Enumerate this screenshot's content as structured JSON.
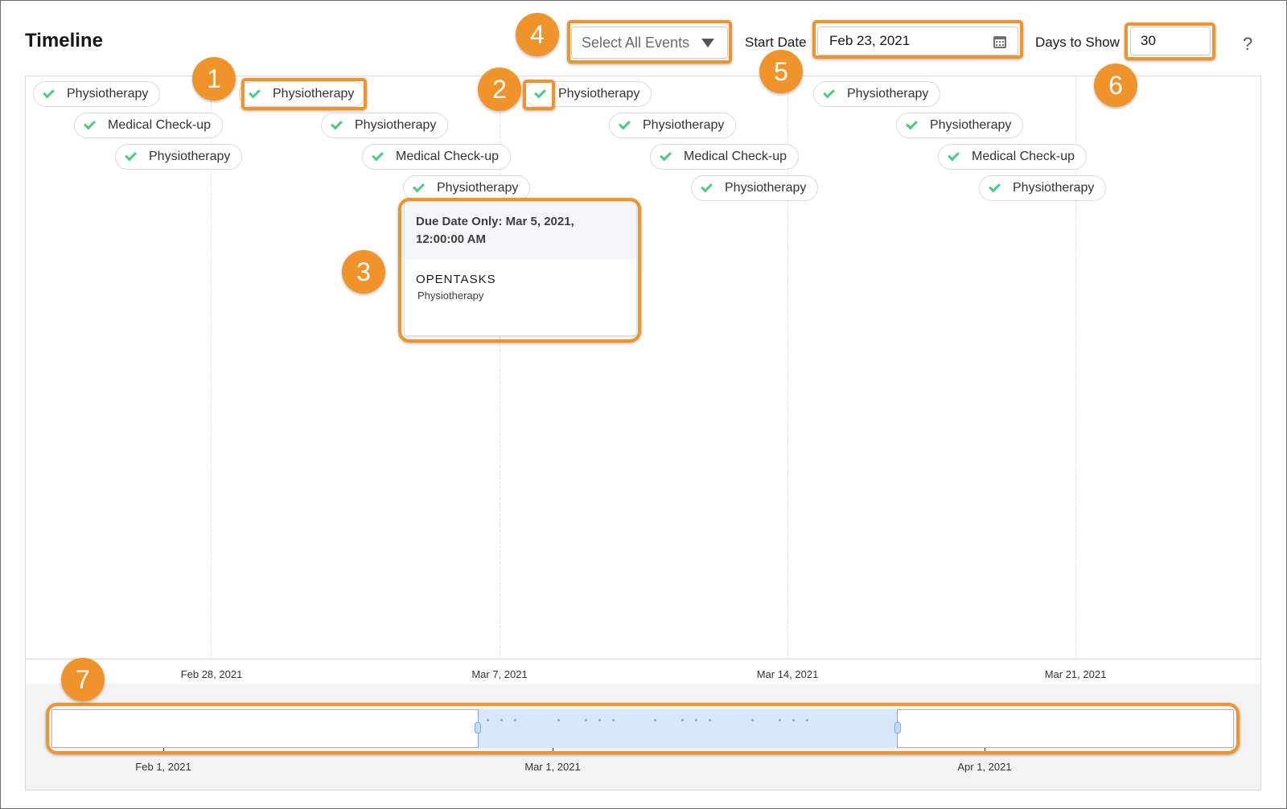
{
  "header": {
    "title": "Timeline",
    "filter_label": "Select All Events",
    "start_date_label": "Start Date",
    "start_date_value": "Feb 23, 2021",
    "days_label": "Days to Show",
    "days_value": "30",
    "help": "?"
  },
  "events": [
    {
      "label": "Physiotherapy"
    },
    {
      "label": "Medical Check-up"
    },
    {
      "label": "Physiotherapy"
    },
    {
      "label": "Physiotherapy"
    },
    {
      "label": "Physiotherapy"
    },
    {
      "label": "Medical Check-up"
    },
    {
      "label": "Physiotherapy"
    },
    {
      "label": "Physiotherapy"
    },
    {
      "label": "Physiotherapy"
    },
    {
      "label": "Medical Check-up"
    },
    {
      "label": "Physiotherapy"
    },
    {
      "label": "Physiotherapy"
    },
    {
      "label": "Physiotherapy"
    },
    {
      "label": "Medical Check-up"
    },
    {
      "label": "Physiotherapy"
    }
  ],
  "popover": {
    "title": "Due Date Only: Mar 5, 2021, 12:00:00 AM",
    "type": "OPENTASKS",
    "subtitle": "Physiotherapy"
  },
  "axis": {
    "labels": [
      "Feb 28, 2021",
      "Mar 7, 2021",
      "Mar 14, 2021",
      "Mar 21, 2021"
    ]
  },
  "scrubber": {
    "labels": [
      "Feb 1, 2021",
      "Mar 1, 2021",
      "Apr 1, 2021"
    ]
  },
  "callouts": [
    "1",
    "2",
    "3",
    "4",
    "5",
    "6",
    "7"
  ],
  "colors": {
    "accent_orange": "#f0932b",
    "check_green": "#4bca81",
    "window_blue": "#d8e7fb"
  }
}
